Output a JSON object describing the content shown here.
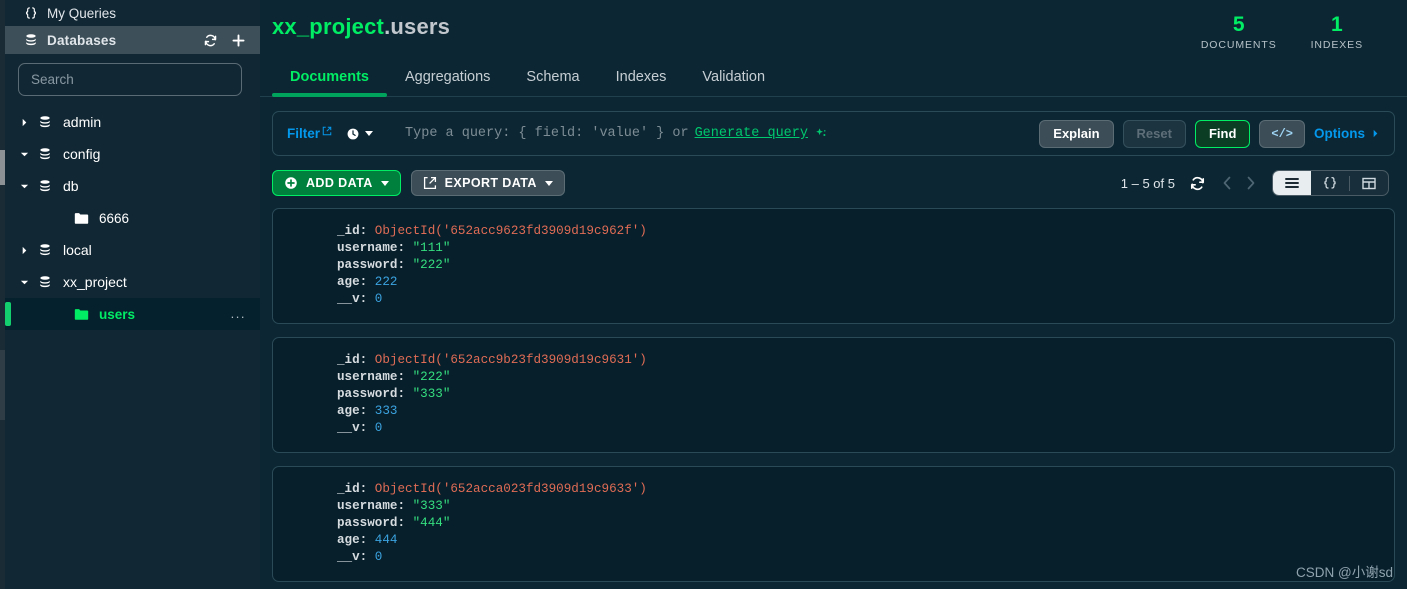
{
  "sidebar": {
    "my_queries": {
      "label": "My Queries",
      "icon": "braces-icon"
    },
    "databases": {
      "label": "Databases",
      "refresh_icon": "refresh-icon",
      "add_icon": "plus-icon"
    },
    "search": {
      "placeholder": "Search",
      "value": ""
    },
    "tree": [
      {
        "label": "admin",
        "type": "database",
        "expanded": false,
        "selected": false
      },
      {
        "label": "config",
        "type": "database",
        "expanded": true,
        "selected": false
      },
      {
        "label": "db",
        "type": "database",
        "expanded": true,
        "selected": false
      },
      {
        "label": "6666",
        "type": "collection",
        "expanded": false,
        "selected": false
      },
      {
        "label": "local",
        "type": "database",
        "expanded": false,
        "selected": false
      },
      {
        "label": "xx_project",
        "type": "database",
        "expanded": true,
        "selected": false
      },
      {
        "label": "users",
        "type": "collection",
        "expanded": false,
        "selected": true,
        "more": "..."
      }
    ]
  },
  "header": {
    "database": "xx_project",
    "separator": ".",
    "collection": "users",
    "stats": [
      {
        "value": "5",
        "label": "DOCUMENTS"
      },
      {
        "value": "1",
        "label": "INDEXES"
      }
    ]
  },
  "tabs": [
    {
      "label": "Documents",
      "active": true
    },
    {
      "label": "Aggregations",
      "active": false
    },
    {
      "label": "Schema",
      "active": false
    },
    {
      "label": "Indexes",
      "active": false
    },
    {
      "label": "Validation",
      "active": false
    }
  ],
  "querybar": {
    "filter_label": "Filter",
    "filter_external_icon": "external-link-icon",
    "history_icon": "clock-icon",
    "history_caret_icon": "chevron-down-icon",
    "placeholder_prefix": "Type a query: { field: 'value' } or",
    "generate_query_label": "Generate query",
    "sparkle_icon": "sparkle-icon",
    "explain_label": "Explain",
    "reset_label": "Reset",
    "find_label": "Find",
    "code_label": "</>",
    "options_label": "Options",
    "options_caret_icon": "chevron-right-icon"
  },
  "toolbar": {
    "add_data_label": "ADD DATA",
    "add_data_icon": "plus-circle-icon",
    "export_data_label": "EXPORT DATA",
    "export_data_icon": "export-icon",
    "range_label": "1 – 5 of 5",
    "refresh_icon": "refresh-icon",
    "prev_icon": "chevron-left-icon",
    "next_icon": "chevron-right-icon",
    "views": [
      {
        "name": "list-view",
        "icon": "list-icon",
        "active": true
      },
      {
        "name": "json-view",
        "icon": "braces-icon",
        "active": false
      },
      {
        "name": "table-view",
        "icon": "table-icon",
        "active": false
      }
    ]
  },
  "documents": [
    {
      "_id": "ObjectId('652acc9623fd3909d19c962f')",
      "username": "\"111\"",
      "password": "\"222\"",
      "age": "222",
      "__v": "0"
    },
    {
      "_id": "ObjectId('652acc9b23fd3909d19c9631')",
      "username": "\"222\"",
      "password": "\"333\"",
      "age": "333",
      "__v": "0"
    },
    {
      "_id": "ObjectId('652acca023fd3909d19c9633')",
      "username": "\"333\"",
      "password": "\"444\"",
      "age": "444",
      "__v": "0"
    }
  ],
  "field_keys": {
    "id": "_id:",
    "username": "username:",
    "password": "password:",
    "age": "age:",
    "v": "__v:"
  },
  "watermark": "CSDN @小谢sd",
  "colors": {
    "accent_green": "#00ed64",
    "link_blue": "#0498ec",
    "string_green": "#35de7f",
    "number_blue": "#3ba3e0",
    "objectid_orange": "#e06c55",
    "sidebar_bg": "#112733",
    "main_bg": "#0c2733"
  }
}
